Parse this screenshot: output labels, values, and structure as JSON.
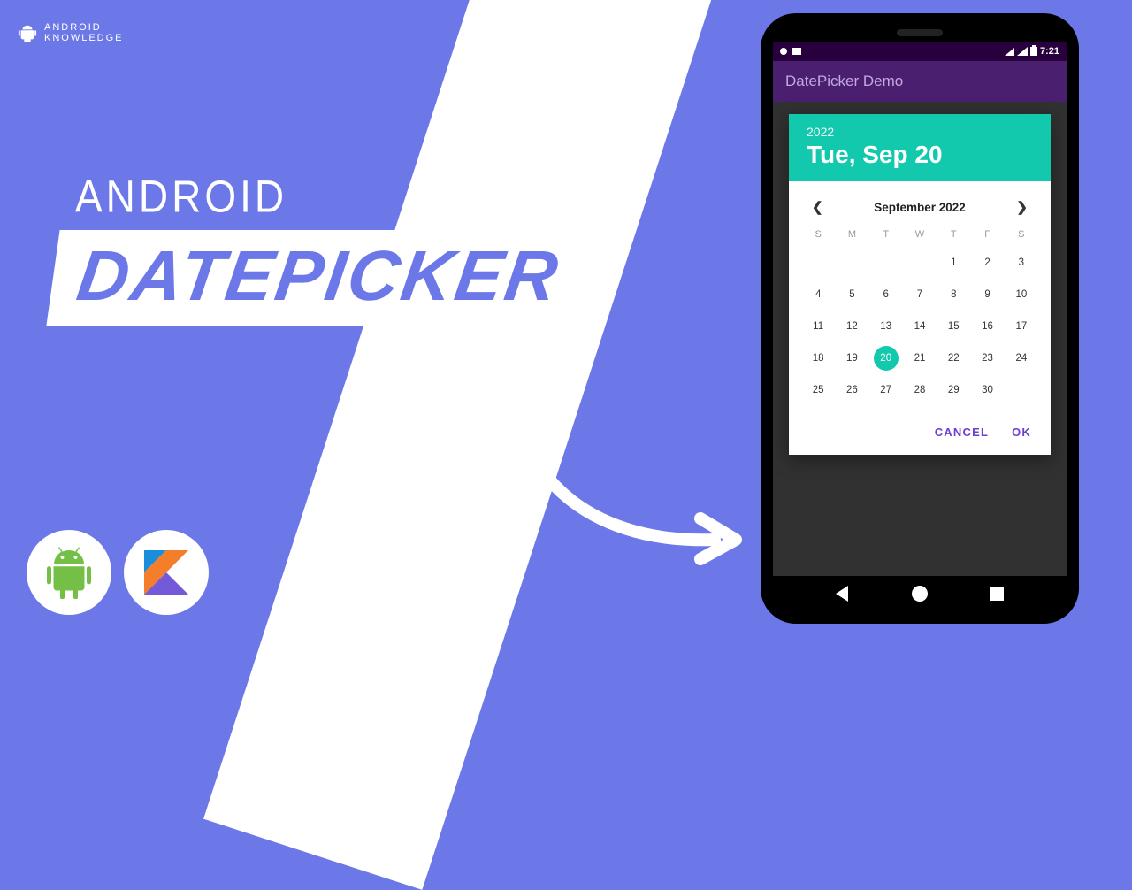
{
  "brand": {
    "line1": "ANDROID",
    "line2": "KNOWLEDGE"
  },
  "headline": {
    "android": "ANDROID",
    "datepicker": "DATEPICKER"
  },
  "phone": {
    "status_time": "7:21",
    "app_title": "DatePicker Demo",
    "datepicker": {
      "year": "2022",
      "date_label": "Tue, Sep 20",
      "month_label": "September 2022",
      "weekdays": [
        "S",
        "M",
        "T",
        "W",
        "T",
        "F",
        "S"
      ],
      "first_weekday_index": 4,
      "days_in_month": 30,
      "selected_day": 20,
      "cancel_label": "CANCEL",
      "ok_label": "OK"
    }
  }
}
